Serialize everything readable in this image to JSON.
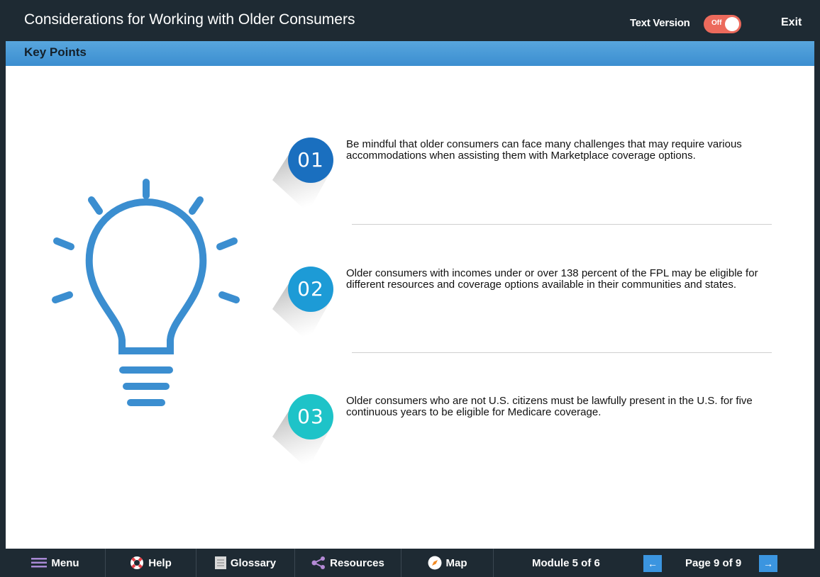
{
  "header": {
    "title": "Considerations for Working with Older Consumers",
    "text_version_label": "Text Version",
    "toggle_state": "Off",
    "exit_label": "Exit"
  },
  "subheader": {
    "title": "Key Points"
  },
  "points": [
    {
      "number": "01",
      "color": "#1a6fbf",
      "text": "Be mindful that older consumers can face many challenges that may require various accommodations when assisting them with Marketplace coverage options."
    },
    {
      "number": "02",
      "color": "#1d9bd6",
      "text": "Older consumers with incomes under or over 138 percent of the FPL may be eligible for different resources and coverage options available in their communities and states."
    },
    {
      "number": "03",
      "color": "#1ec3c8",
      "text": "Older consumers who are not U.S. citizens must be lawfully present in the U.S. for five continuous years to be eligible for Medicare coverage."
    }
  ],
  "footer": {
    "menu_label": "Menu",
    "help_label": "Help",
    "glossary_label": "Glossary",
    "resources_label": "Resources",
    "map_label": "Map",
    "module_text": "Module 5 of 6",
    "page_text": "Page 9 of 9",
    "prev_icon": "←",
    "next_icon": "→"
  },
  "colors": {
    "topbar": "#1e2a33",
    "accent_blue": "#3b8ed0",
    "toggle_off": "#ec6a5c",
    "bulb": "#3b8ed0"
  }
}
